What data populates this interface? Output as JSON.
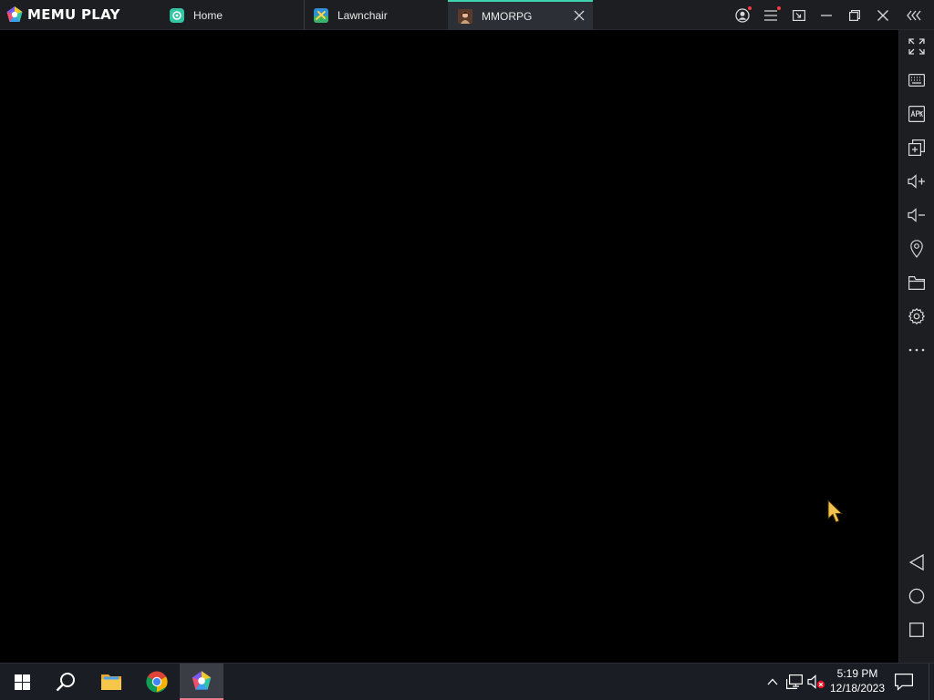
{
  "app": {
    "brand": "MEMU PLAY",
    "colors": {
      "titlebar_bg": "#1c1e22",
      "active_tab_bg": "#2c3036",
      "accent": "#3ed3b0",
      "taskbar_bg": "#1a1d24",
      "screen_bg": "#000000"
    }
  },
  "tabs": [
    {
      "label": "Home",
      "icon": "memu-home-icon",
      "active": false
    },
    {
      "label": "Lawnchair",
      "icon": "lawnchair-app-icon",
      "active": false
    },
    {
      "label": "MMORPG",
      "icon": "mmorpg-game-icon",
      "active": true,
      "closable": true
    }
  ],
  "window_controls": {
    "account": "account-icon",
    "menu": "hamburger-menu-icon",
    "mini_mode": "mini-mode-icon",
    "minimize": "minimize-icon",
    "restore": "restore-icon",
    "close": "close-icon",
    "collapse_sidebar": "collapse-sidebar-icon"
  },
  "sidebar": {
    "top": [
      "fullscreen-icon",
      "keyboard-mapping-icon",
      "apk-install-icon",
      "multi-instance-icon",
      "volume-up-icon",
      "volume-down-icon",
      "location-icon",
      "shared-folder-icon",
      "settings-icon",
      "more-icon"
    ],
    "bottom": [
      "android-back-icon",
      "android-home-icon",
      "android-recents-icon"
    ]
  },
  "taskbar": {
    "apps": [
      "windows-start-icon",
      "search-icon",
      "file-explorer-icon",
      "chrome-icon",
      "memu-taskbar-icon"
    ],
    "tray": [
      "show-hidden-icons-chevron",
      "network-icon",
      "volume-muted-icon"
    ],
    "clock": {
      "time": "5:19 PM",
      "date": "12/18/2023"
    },
    "notifications": "action-center-icon"
  }
}
